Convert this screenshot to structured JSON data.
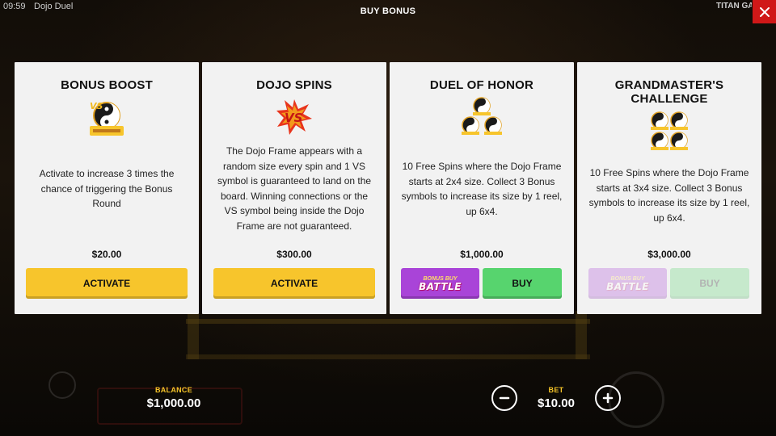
{
  "topbar": {
    "clock": "09:59",
    "game_name": "Dojo Duel",
    "title": "BUY BONUS",
    "brand": "TITAN GA"
  },
  "cards": [
    {
      "title": "BONUS BOOST",
      "icon": "vs-bonus-icon",
      "description": "Activate to increase 3 times the chance of triggering the Bonus Round",
      "price": "$20.00",
      "button": "ACTIVATE"
    },
    {
      "title": "DOJO SPINS",
      "icon": "vs-burst-icon",
      "description": "The Dojo Frame appears with a random size every spin and 1 VS symbol is guaranteed to land on the board. Winning connections or the VS symbol being inside the Dojo Frame are not guaranteed.",
      "price": "$300.00",
      "button": "ACTIVATE"
    },
    {
      "title": "DUEL OF HONOR",
      "icon": "three-yin-yang-icon",
      "description": "10 Free Spins where the Dojo Frame starts at 2x4 size. Collect 3 Bonus symbols to increase its size by 1 reel, up 6x4.",
      "price": "$1,000.00",
      "battle_small": "BONUS BUY",
      "battle_big": "BATTLE",
      "button": "BUY"
    },
    {
      "title": "GRANDMASTER'S CHALLENGE",
      "icon": "four-yin-yang-icon",
      "description": "10 Free Spins where the Dojo Frame starts at 3x4 size. Collect 3 Bonus symbols to increase its size by 1 reel, up 6x4.",
      "price": "$3,000.00",
      "battle_small": "BONUS BUY",
      "battle_big": "BATTLE",
      "button": "BUY",
      "disabled": true
    }
  ],
  "footer": {
    "balance_label": "BALANCE",
    "balance_value": "$1,000.00",
    "bet_label": "BET",
    "bet_value": "$10.00"
  },
  "colors": {
    "accent_yellow": "#f7c52c",
    "buy_green": "#57d46e",
    "battle_purple": "#a944d8",
    "close_red": "#d01818",
    "label_gold": "#f5c428"
  }
}
